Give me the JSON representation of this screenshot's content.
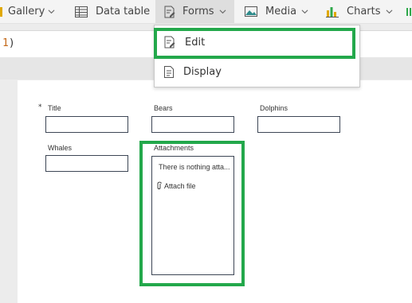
{
  "ribbon": {
    "items": [
      {
        "label": "Gallery",
        "icon": "gallery-icon",
        "has_dropdown": true
      },
      {
        "label": "Data table",
        "icon": "table-icon",
        "has_dropdown": false
      },
      {
        "label": "Forms",
        "icon": "form-icon",
        "has_dropdown": true,
        "active": true
      },
      {
        "label": "Media",
        "icon": "image-icon",
        "has_dropdown": true
      },
      {
        "label": "Charts",
        "icon": "chart-icon",
        "has_dropdown": true
      }
    ]
  },
  "formula": {
    "text_num": "1",
    "text_rest": ")"
  },
  "forms_menu": {
    "items": [
      {
        "label": "Edit",
        "icon": "edit-form-icon",
        "highlighted": true
      },
      {
        "label": "Display",
        "icon": "display-form-icon",
        "highlighted": false
      }
    ]
  },
  "form": {
    "required_mark": "*",
    "fields": [
      {
        "label": "Title",
        "value": ""
      },
      {
        "label": "Bears",
        "value": ""
      },
      {
        "label": "Dolphins",
        "value": ""
      },
      {
        "label": "Whales",
        "value": ""
      }
    ],
    "attachments": {
      "label": "Attachments",
      "empty_text": "There is nothing atta...",
      "attach_label": "Attach file"
    }
  },
  "colors": {
    "highlight": "#23a84b",
    "accent_orange": "#c46a1a",
    "chart_gold": "#e0a800",
    "chart_green": "#2ea84a"
  }
}
